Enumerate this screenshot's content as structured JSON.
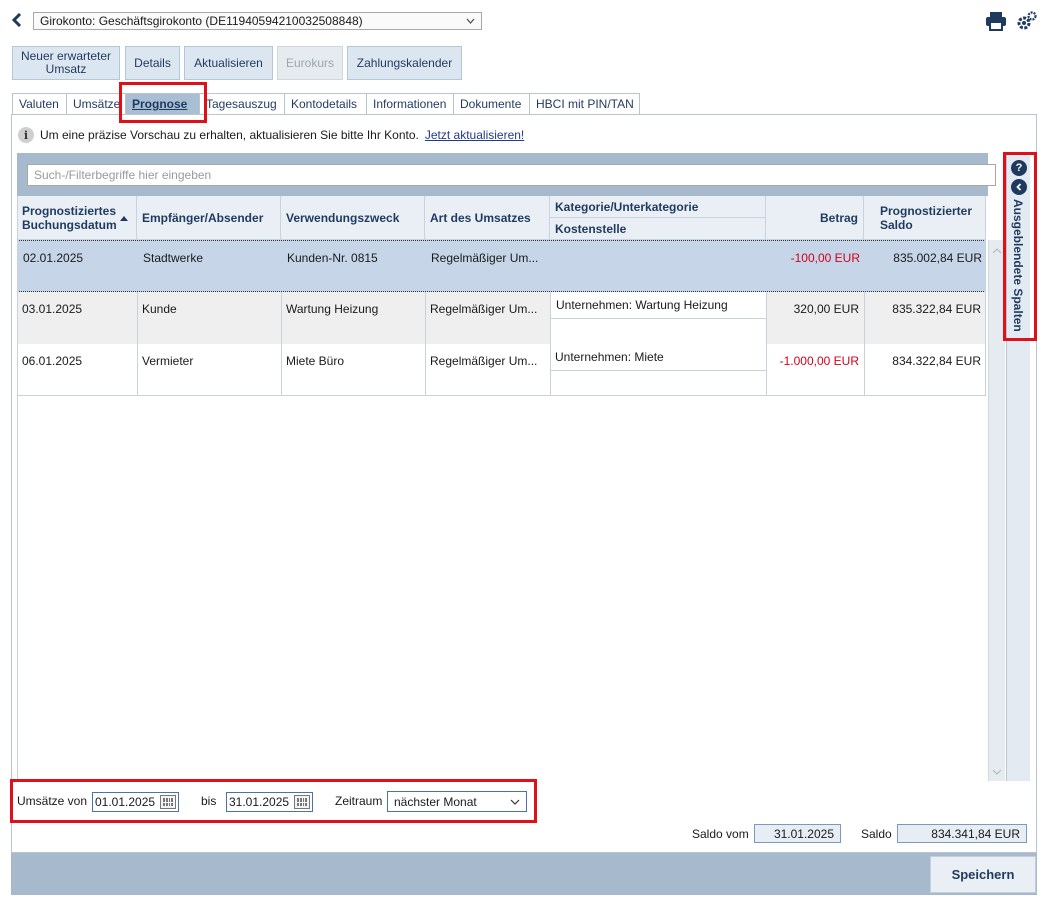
{
  "header": {
    "account_select": "Girokonto: Geschäftsgirokonto (DE11940594210032508848)"
  },
  "toolbar": {
    "new_expected": "Neuer erwarteter Umsatz",
    "details": "Details",
    "refresh": "Aktualisieren",
    "eurokurs": "Eurokurs",
    "payment_calendar": "Zahlungskalender"
  },
  "tabs": [
    "Valuten",
    "Umsätze",
    "Prognose",
    "Tagesauszug",
    "Kontodetails",
    "Informationen",
    "Dokumente",
    "HBCI mit PIN/TAN"
  ],
  "info": {
    "text": "Um eine präzise Vorschau zu erhalten, aktualisieren Sie bitte Ihr Konto.",
    "link": "Jetzt aktualisieren!"
  },
  "filter": {
    "placeholder": "Such-/Filterbegriffe hier eingeben"
  },
  "columns": {
    "date": "Prognostiziertes Buchungsdatum",
    "partner": "Empfänger/Absender",
    "purpose": "Verwendungszweck",
    "type": "Art des Umsatzes",
    "category": "Kategorie/Unterkategorie",
    "cost_center": "Kostenstelle",
    "amount": "Betrag",
    "balance": "Prognostizierter Saldo"
  },
  "rows": [
    {
      "date": "02.01.2025",
      "partner": "Stadtwerke",
      "purpose": "Kunden-Nr. 0815",
      "type": "Regelmäßiger Um...",
      "category": "",
      "cost_center": "",
      "amount": "-100,00 EUR",
      "balance": "835.002,84 EUR"
    },
    {
      "date": "03.01.2025",
      "partner": "Kunde",
      "purpose": "Wartung Heizung",
      "type": "Regelmäßiger Um...",
      "category": "Unternehmen: Wartung Heizung",
      "cost_center": "",
      "amount": "320,00 EUR",
      "balance": "835.322,84 EUR"
    },
    {
      "date": "06.01.2025",
      "partner": "Vermieter",
      "purpose": "Miete Büro",
      "type": "Regelmäßiger Um...",
      "category": "Unternehmen: Miete",
      "cost_center": "",
      "amount": "-1.000,00 EUR",
      "balance": "834.322,84 EUR"
    }
  ],
  "side_panel": {
    "label": "Ausgeblendete Spalten"
  },
  "period": {
    "from_label": "Umsätze von",
    "from_value": "01.01.2025",
    "to_label": "bis",
    "to_value": "31.01.2025",
    "range_label": "Zeitraum",
    "range_value": "nächster Monat"
  },
  "saldo": {
    "date_label": "Saldo vom",
    "date_value": "31.01.2025",
    "label": "Saldo",
    "value": "834.341,84 EUR"
  },
  "footer": {
    "save": "Speichern"
  },
  "colors": {
    "negative": "#d0021b",
    "accent": "#1f3a5f",
    "highlight": "#e0101a"
  }
}
